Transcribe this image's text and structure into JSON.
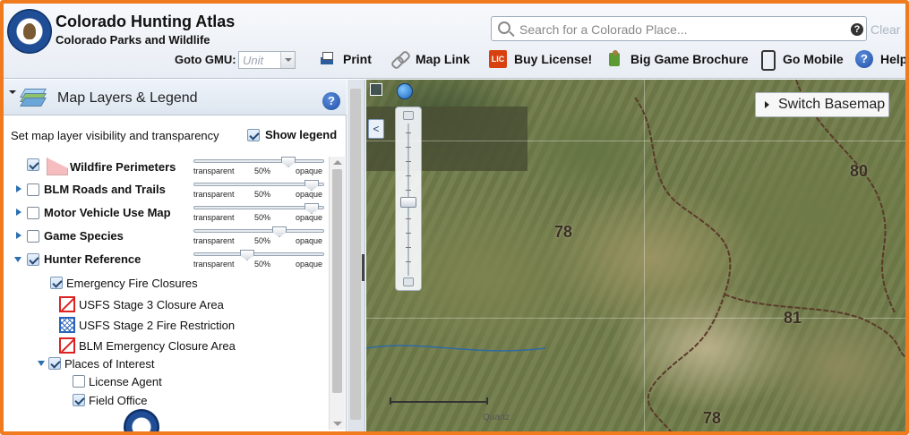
{
  "header": {
    "title": "Colorado Hunting Atlas",
    "subtitle": "Colorado Parks and Wildlife",
    "goto_gmu_label": "Goto GMU:",
    "gmu_placeholder": "Unit",
    "search_placeholder": "Search for a Colorado Place...",
    "help_symbol": "?",
    "clear_label": "Clear"
  },
  "toolbar": {
    "print": "Print",
    "map_link": "Map Link",
    "buy_license": "Buy License!",
    "license_icon_text": "LIC",
    "brochure": "Big Game Brochure",
    "go_mobile": "Go Mobile",
    "help": "Help"
  },
  "panel": {
    "title": "Map Layers & Legend",
    "help_symbol": "?",
    "visibility_text": "Set map layer visibility and transparency",
    "show_legend_label": "Show legend",
    "slider_labels": {
      "left": "transparent",
      "mid": "50%",
      "right": "opaque"
    },
    "layers": [
      {
        "name": "Wildfire Perimeters",
        "checked": true,
        "opacity": 0.75
      },
      {
        "name": "BLM Roads and Trails",
        "checked": false,
        "opacity": 0.95
      },
      {
        "name": "Motor Vehicle Use Map",
        "checked": false,
        "opacity": 0.95
      },
      {
        "name": "Game Species",
        "checked": false,
        "opacity": 0.68
      },
      {
        "name": "Hunter Reference",
        "checked": true,
        "opacity": 0.4
      }
    ],
    "sublayers": {
      "emergency_fire_closures": "Emergency Fire Closures",
      "usfs_stage3": "USFS Stage 3 Closure Area",
      "usfs_stage2": "USFS Stage 2 Fire Restriction",
      "blm_emergency": "BLM Emergency Closure Area",
      "places_of_interest": "Places of Interest",
      "license_agent": "License Agent",
      "field_office": "Field Office"
    }
  },
  "map": {
    "collapse_symbol": "<",
    "switch_basemap": "Switch Basemap",
    "gmu_labels": [
      "78",
      "80",
      "81",
      "78"
    ],
    "attribution": "Quartz"
  },
  "colors": {
    "frame": "#f07b1e",
    "header_bg": "#e8edf4",
    "closure_red": "#dd2222",
    "restriction_blue": "#2a63b8",
    "wildfire_pink": "#f5bdbf"
  }
}
